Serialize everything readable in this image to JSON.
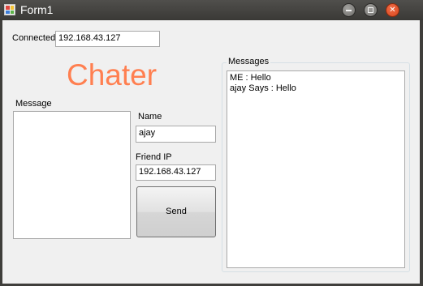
{
  "window": {
    "title": "Form1",
    "icon": "form-app-icon",
    "controls": {
      "minimize": "minimize-icon",
      "maximize": "maximize-icon",
      "close": "close-icon",
      "close_glyph": "✕"
    }
  },
  "status": {
    "connected_label": "Connected",
    "connected_ip": "192.168.43.127"
  },
  "heading": "Chater",
  "message": {
    "label": "Message",
    "value": ""
  },
  "name": {
    "label": "Name",
    "value": "ajay"
  },
  "friend_ip": {
    "label": "Friend IP",
    "value": "192.168.43.127"
  },
  "send_button": {
    "label": "Send"
  },
  "messages": {
    "label": "Messages",
    "lines": [
      "ME : Hello",
      "ajay Says : Hello"
    ]
  }
}
